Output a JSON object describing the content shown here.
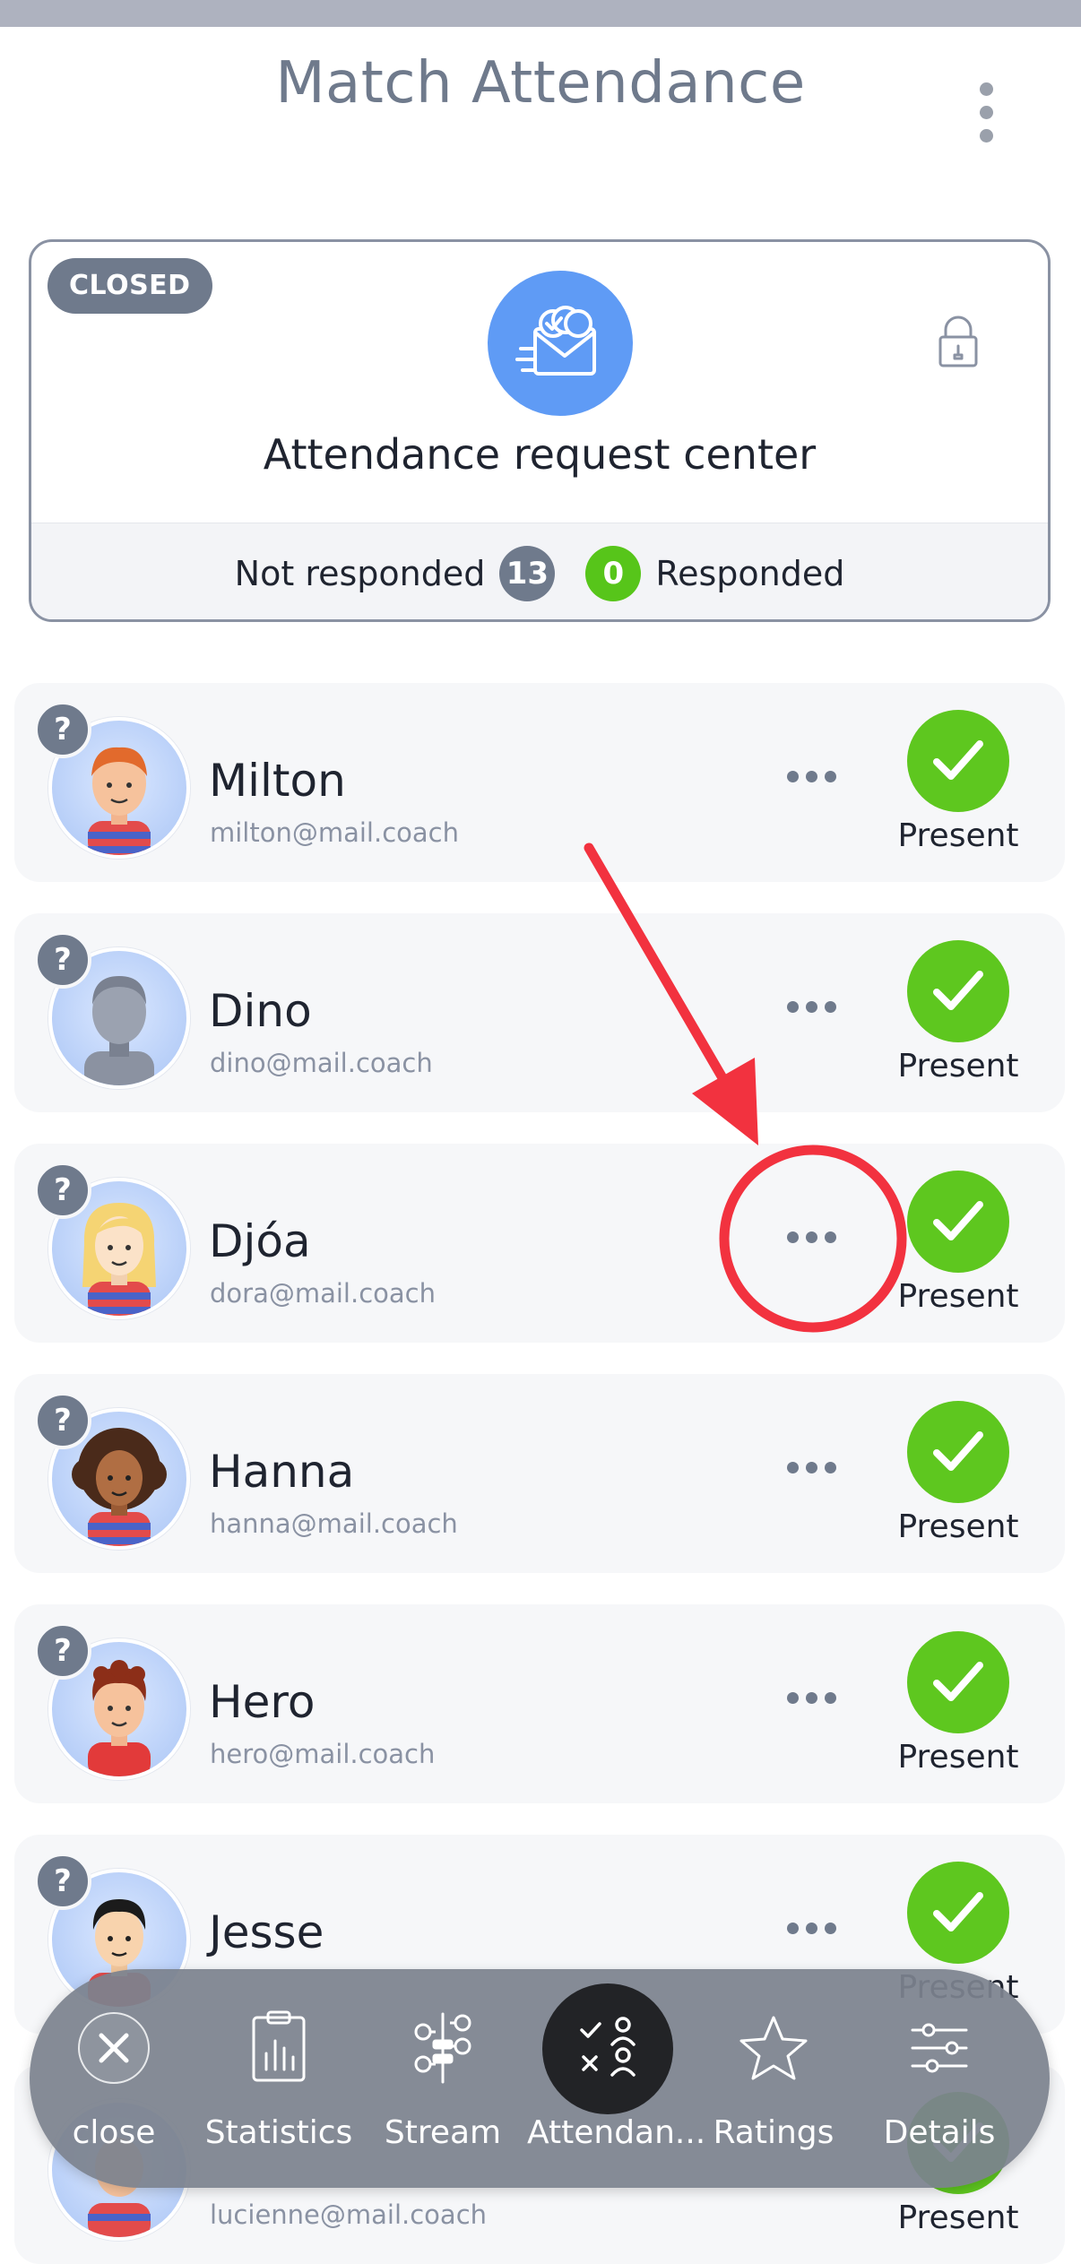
{
  "header": {
    "title": "Match Attendance"
  },
  "request_center": {
    "status_badge": "CLOSED",
    "title": "Attendance request center",
    "not_responded_label": "Not responded",
    "not_responded_count": "13",
    "responded_count": "0",
    "responded_label": "Responded"
  },
  "players": [
    {
      "name": "Milton",
      "email": "milton@mail.coach",
      "status": "Present",
      "badge": "?"
    },
    {
      "name": "Dino",
      "email": "dino@mail.coach",
      "status": "Present",
      "badge": "?"
    },
    {
      "name": "Djóa",
      "email": "dora@mail.coach",
      "status": "Present",
      "badge": "?"
    },
    {
      "name": "Hanna",
      "email": "hanna@mail.coach",
      "status": "Present",
      "badge": "?"
    },
    {
      "name": "Hero",
      "email": "hero@mail.coach",
      "status": "Present",
      "badge": "?"
    },
    {
      "name": "Jesse",
      "email": "",
      "status": "Present",
      "badge": "?"
    },
    {
      "name": "",
      "email": "lucienne@mail.coach",
      "status": "Present",
      "badge": ""
    }
  ],
  "bottom_nav": {
    "items": [
      {
        "label": "close",
        "icon": "close-icon"
      },
      {
        "label": "Statistics",
        "icon": "clipboard-chart-icon"
      },
      {
        "label": "Stream",
        "icon": "stream-icon"
      },
      {
        "label": "Attendan...",
        "icon": "attendance-icon",
        "active": true
      },
      {
        "label": "Ratings",
        "icon": "star-icon"
      },
      {
        "label": "Details",
        "icon": "sliders-icon"
      }
    ]
  },
  "colors": {
    "accent_blue": "#5f9bf5",
    "present_green": "#5ec71f",
    "badge_grey": "#6f7a8c",
    "annotation_red": "#f2323f"
  }
}
